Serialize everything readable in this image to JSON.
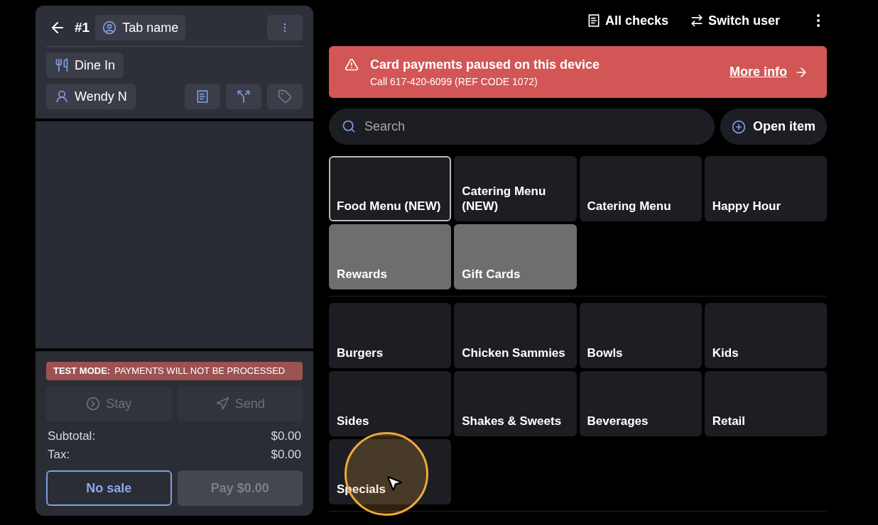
{
  "order": {
    "number": "#1",
    "tab_name": "Tab name",
    "dining_option": "Dine In",
    "server": "Wendy N",
    "test_mode": {
      "label": "TEST MODE:",
      "message": "PAYMENTS WILL NOT BE PROCESSED"
    },
    "actions": [
      {
        "label": "Stay",
        "kind": "stay",
        "disabled": true
      },
      {
        "label": "Send",
        "kind": "send",
        "disabled": true
      }
    ],
    "totals": [
      {
        "label": "Subtotal:",
        "value": "$0.00"
      },
      {
        "label": "Tax:",
        "value": "$0.00"
      }
    ],
    "footer_buttons": [
      {
        "label": "No sale",
        "disabled": false
      },
      {
        "label": "Pay $0.00",
        "disabled": true
      }
    ]
  },
  "top_bar": [
    {
      "label": "All checks",
      "kind": "checks"
    },
    {
      "label": "Switch user",
      "kind": "switch"
    }
  ],
  "alert": {
    "title": "Card payments paused on this device",
    "detail": "Call 617-420-6099 (REF CODE 1072)",
    "link": "More info"
  },
  "search": {
    "placeholder": "Search"
  },
  "open_item": "Open item",
  "tile_groups": [
    [
      {
        "label": "Food Menu (NEW)",
        "kind": "menu",
        "selected": true
      },
      {
        "label": "Catering Menu (NEW)",
        "kind": "menu",
        "selected": false
      },
      {
        "label": "Catering Menu",
        "kind": "menu",
        "selected": false
      },
      {
        "label": "Happy Hour",
        "kind": "menu",
        "selected": false
      },
      {
        "label": "Rewards",
        "kind": "program",
        "selected": false
      },
      {
        "label": "Gift Cards",
        "kind": "program",
        "selected": false
      }
    ],
    [
      {
        "label": "Burgers",
        "kind": "menu",
        "selected": false
      },
      {
        "label": "Chicken Sammies",
        "kind": "menu",
        "selected": false
      },
      {
        "label": "Bowls",
        "kind": "menu",
        "selected": false
      },
      {
        "label": "Kids",
        "kind": "menu",
        "selected": false
      },
      {
        "label": "Sides",
        "kind": "menu",
        "selected": false
      },
      {
        "label": "Shakes & Sweets",
        "kind": "menu",
        "selected": false
      },
      {
        "label": "Beverages",
        "kind": "menu",
        "selected": false
      },
      {
        "label": "Retail",
        "kind": "menu",
        "selected": false
      },
      {
        "label": "Specials",
        "kind": "menu",
        "selected": false
      }
    ]
  ]
}
